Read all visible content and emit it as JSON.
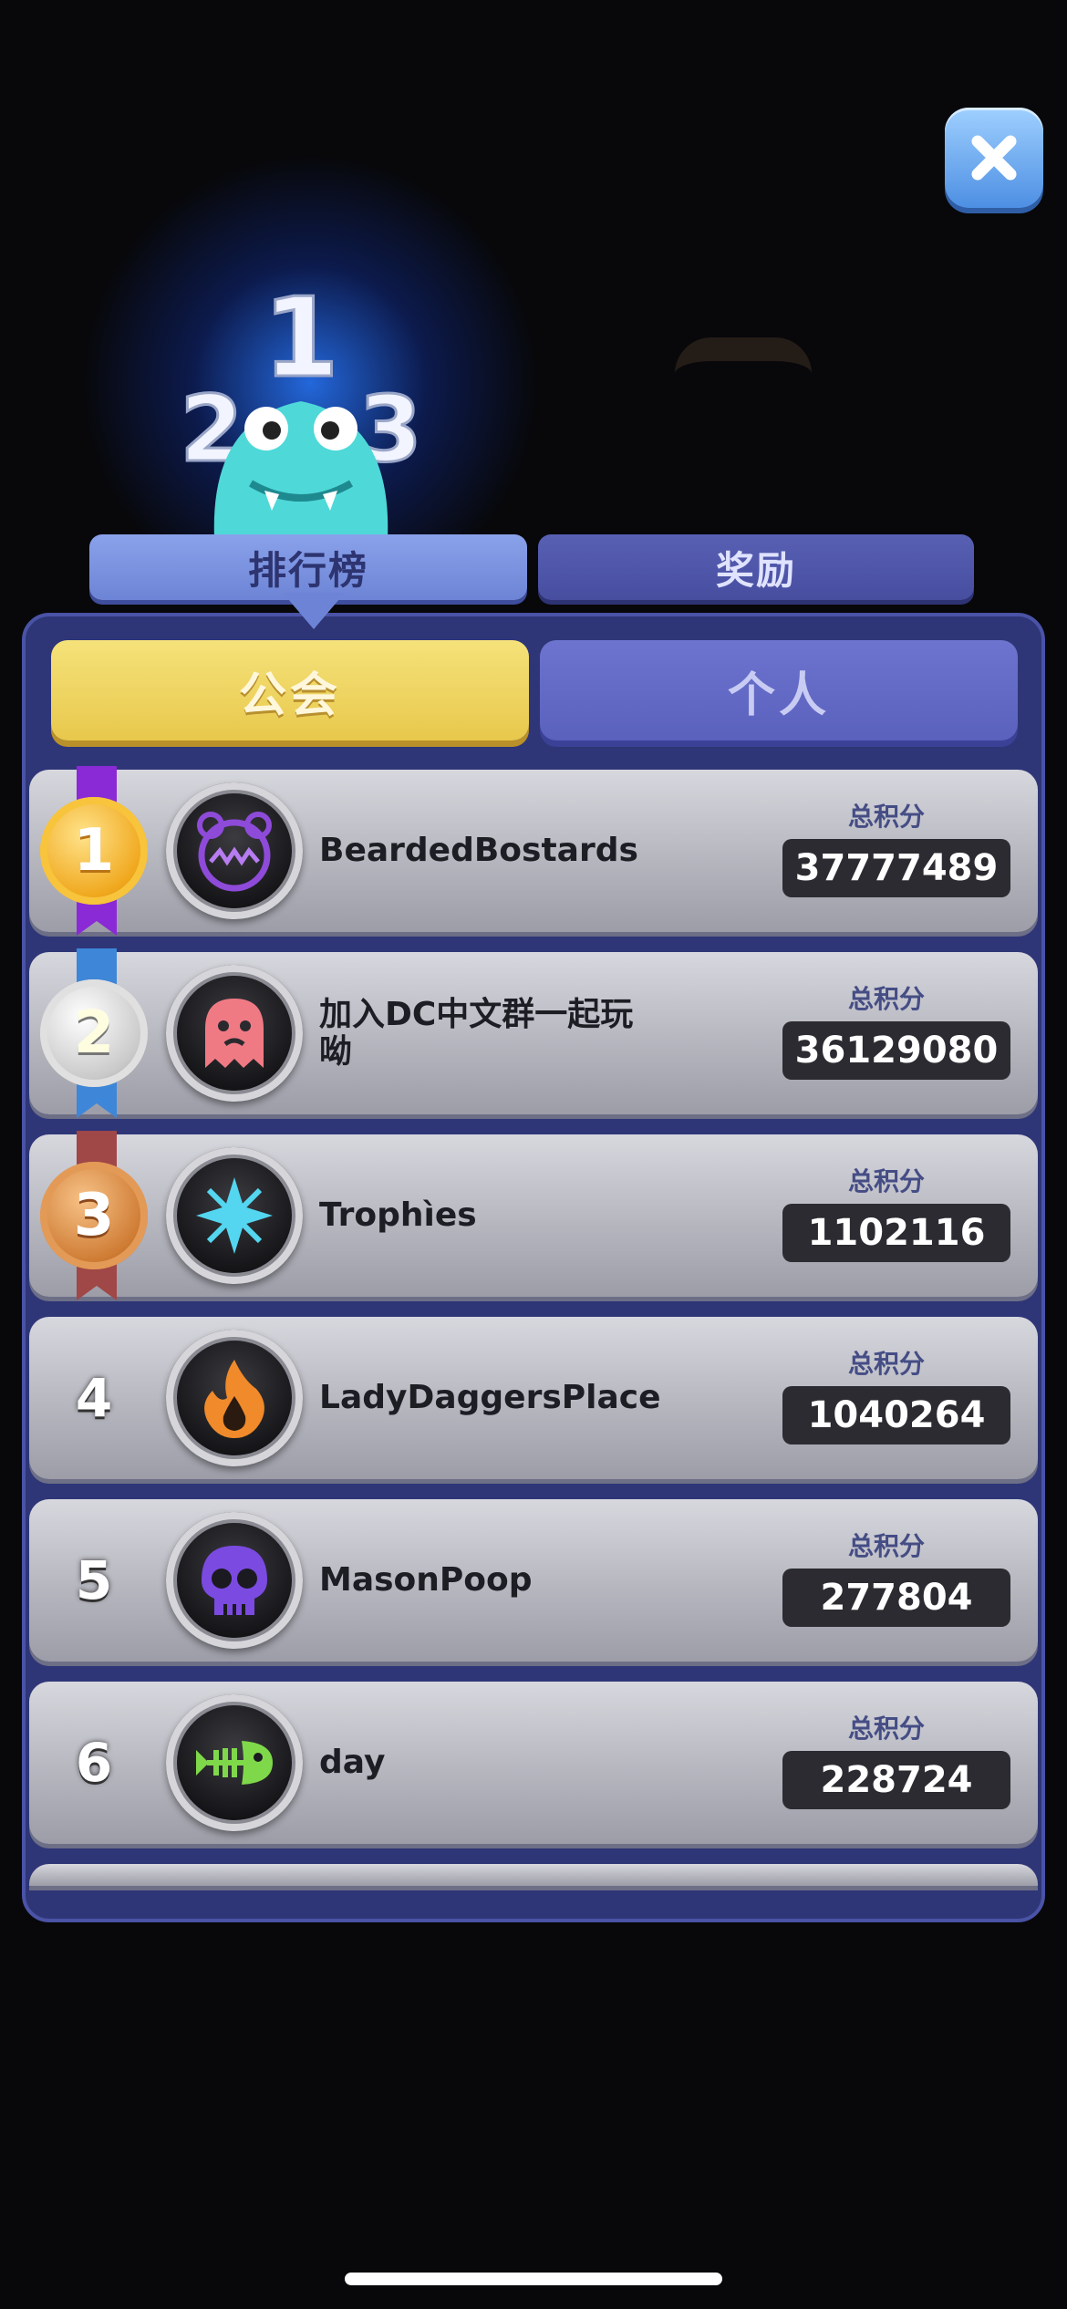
{
  "header": {
    "close_icon": "close-x-icon",
    "mascot_icon": "trophy-monster-123-icon",
    "mascot_numbers": {
      "first": "1",
      "second": "2",
      "third": "3"
    }
  },
  "tabs": [
    {
      "label": "排行榜",
      "active": true
    },
    {
      "label": "奖励",
      "active": false
    }
  ],
  "segments": [
    {
      "label": "公会",
      "active": true
    },
    {
      "label": "个人",
      "active": false
    }
  ],
  "colors": {
    "accent_yellow": "#e8c84c",
    "panel_blue": "#2e3677",
    "tab_blue": "#6d84d6"
  },
  "leaderboard": [
    {
      "rank": "1",
      "medal": "gold",
      "ribbon": "#8a2ad6",
      "emblem": "purple-bear-icon",
      "name": "BeardedBostards",
      "score_label": "总积分",
      "score": "37777489"
    },
    {
      "rank": "2",
      "medal": "silver",
      "ribbon": "#3e86d8",
      "emblem": "pink-ghost-icon",
      "name": "加入DC中文群一起玩呦",
      "score_label": "总积分",
      "score": "36129080"
    },
    {
      "rank": "3",
      "medal": "bronze",
      "ribbon": "#a04747",
      "emblem": "cyan-star-icon",
      "name": "Trophìes",
      "score_label": "总积分",
      "score": "1102116"
    },
    {
      "rank": "4",
      "medal": "",
      "ribbon": "",
      "emblem": "orange-flame-icon",
      "name": "LadyDaggersPlace",
      "score_label": "总积分",
      "score": "1040264"
    },
    {
      "rank": "5",
      "medal": "",
      "ribbon": "",
      "emblem": "purple-skull-icon",
      "name": "MasonPoop",
      "score_label": "总积分",
      "score": "277804"
    },
    {
      "rank": "6",
      "medal": "",
      "ribbon": "",
      "emblem": "green-fish-icon",
      "name": "day",
      "score_label": "总积分",
      "score": "228724"
    }
  ]
}
